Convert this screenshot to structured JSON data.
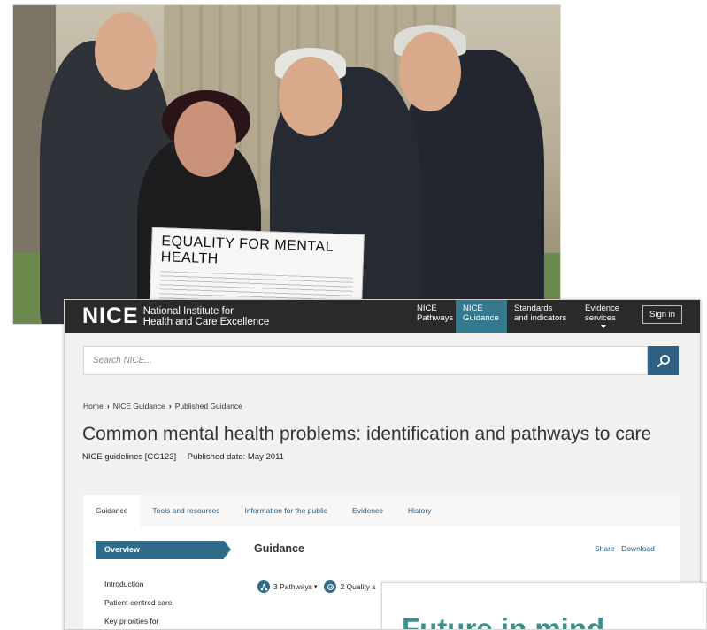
{
  "photo": {
    "sign_text": "EQUALITY FOR MENTAL HEALTH"
  },
  "site": {
    "logo_mark": "NICE",
    "logo_line1": "National Institute for",
    "logo_line2": "Health and Care Excellence",
    "nav": [
      {
        "line1": "NICE",
        "line2": "Pathways"
      },
      {
        "line1": "NICE",
        "line2": "Guidance"
      },
      {
        "line1": "Standards",
        "line2": "and indicators"
      },
      {
        "line1": "Evidence",
        "line2": "services"
      }
    ],
    "signin_label": "Sign in",
    "accent": "#337a8f"
  },
  "search": {
    "placeholder": "Search NICE...",
    "button_icon": "search-icon"
  },
  "breadcrumb": [
    "Home",
    "NICE Guidance",
    "Published Guidance"
  ],
  "page": {
    "title": "Common mental health problems: identification and pathways to care",
    "guideline_code": "NICE guidelines [CG123]",
    "published": "Published date: May 2011"
  },
  "tabs": [
    "Guidance",
    "Tools and resources",
    "Information for the public",
    "Evidence",
    "History"
  ],
  "guidance": {
    "overview_label": "Overview",
    "section_title": "Guidance",
    "share_label": "Share",
    "download_label": "Download",
    "sidebar": [
      "Introduction",
      "Patient-centred care",
      "Key priorities for"
    ],
    "chip_pathways": "3 Pathways",
    "chip_quality": "2 Quality s"
  },
  "overlay": {
    "title": "Future in mind"
  }
}
